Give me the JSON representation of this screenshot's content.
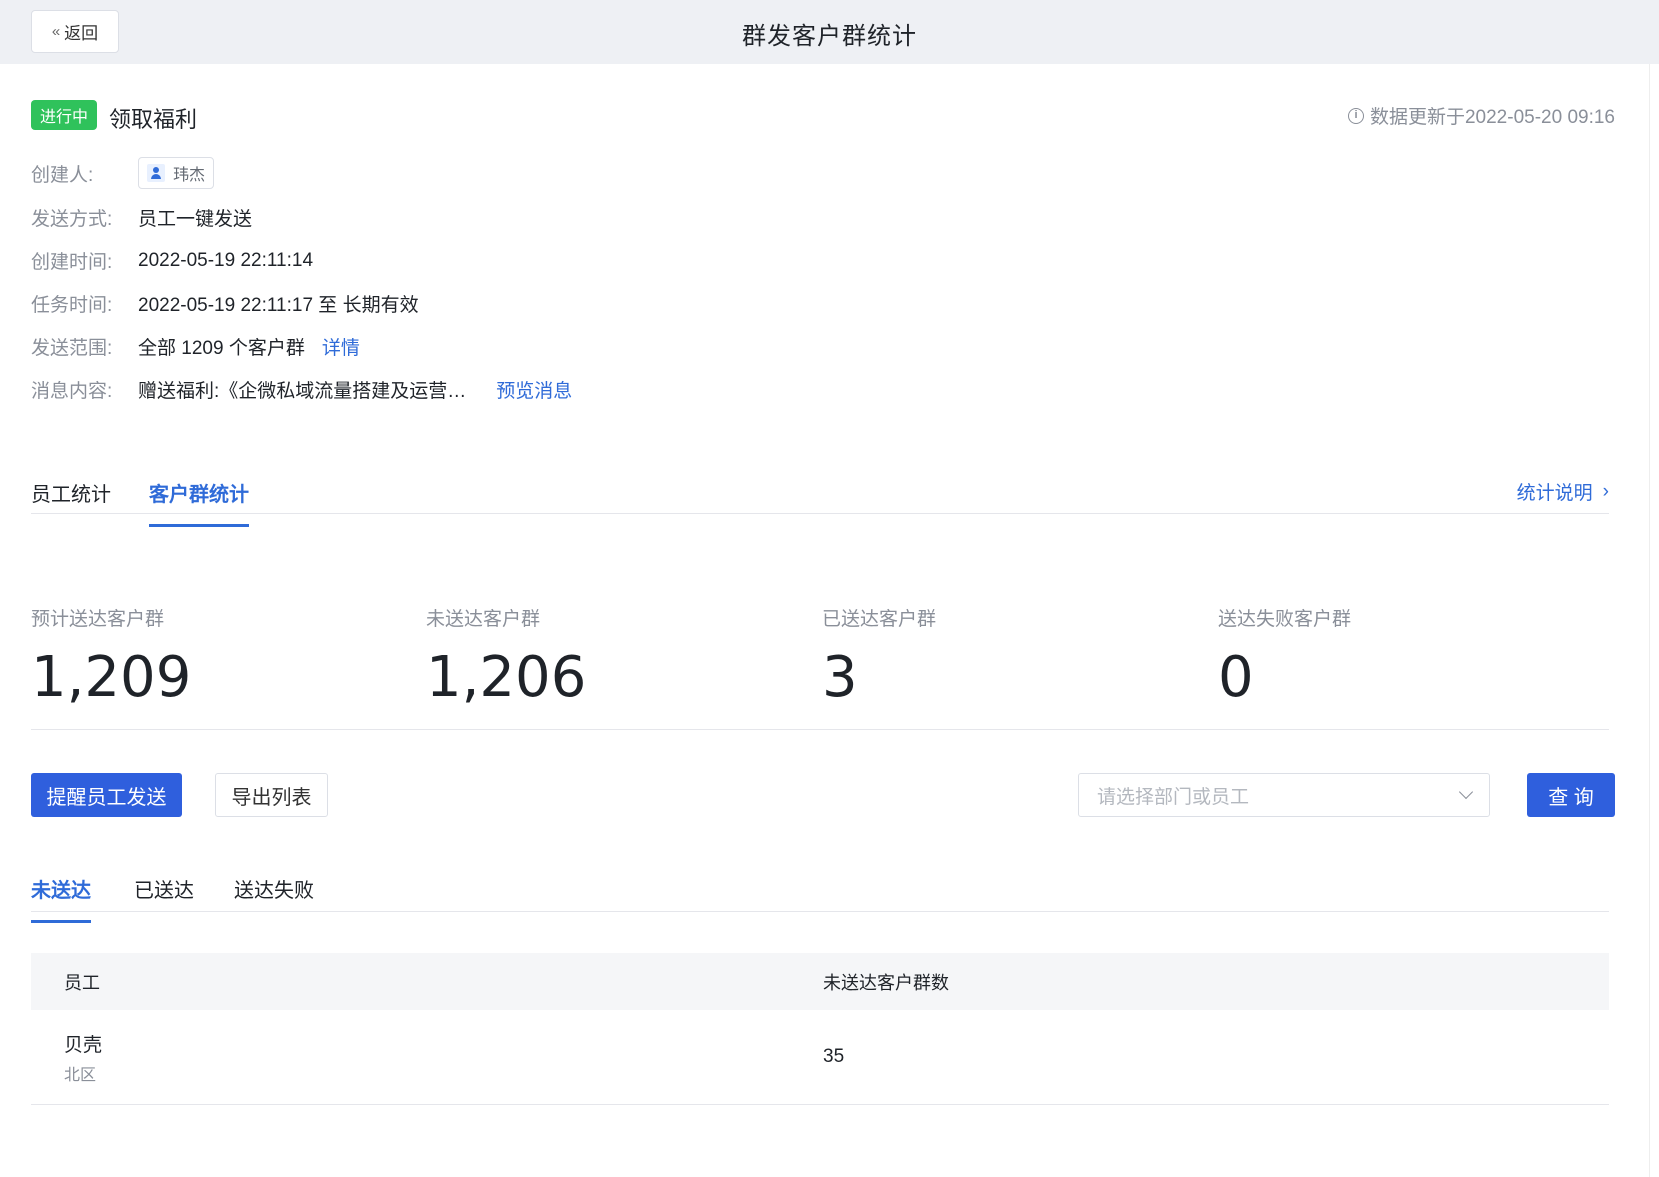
{
  "header": {
    "back_label": "返回",
    "title": "群发客户群统计"
  },
  "task": {
    "status": "进行中",
    "name": "领取福利",
    "updated_text": "数据更新于2022-05-20 09:16",
    "info_icon": "info-icon"
  },
  "meta": {
    "creator_label": "创建人:",
    "creator_value": "玮杰",
    "send_method_label": "发送方式:",
    "send_method_value": "员工一键发送",
    "created_time_label": "创建时间:",
    "created_time_value": "2022-05-19 22:11:14",
    "task_time_label": "任务时间:",
    "task_time_value": "2022-05-19 22:11:17 至 长期有效",
    "scope_label": "发送范围:",
    "scope_value": "全部 1209 个客户群",
    "scope_link": "详情",
    "content_label": "消息内容:",
    "content_value": "赠送福利:《企微私域流量搭建及运营…",
    "content_link": "预览消息"
  },
  "stat_tabs": {
    "tab_staff": "员工统计",
    "tab_group": "客户群统计",
    "explain": "统计说明"
  },
  "stats": {
    "planned_label": "预计送达客户群",
    "planned_value": "1,209",
    "undelivered_label": "未送达客户群",
    "undelivered_value": "1,206",
    "delivered_label": "已送达客户群",
    "delivered_value": "3",
    "failed_label": "送达失败客户群",
    "failed_value": "0"
  },
  "actions": {
    "remind_label": "提醒员工发送",
    "export_label": "导出列表",
    "select_placeholder": "请选择部门或员工",
    "query_label": "查 询"
  },
  "list_tabs": {
    "undelivered": "未送达",
    "delivered": "已送达",
    "failed": "送达失败"
  },
  "table": {
    "col_staff": "员工",
    "col_count": "未送达客户群数",
    "rows": [
      {
        "name": "贝壳",
        "dept": "北区",
        "count": "35"
      }
    ]
  },
  "colors": {
    "accent": "#2f6bd8",
    "status_green": "#2fc25b",
    "primary_button": "#2f5fdd"
  }
}
